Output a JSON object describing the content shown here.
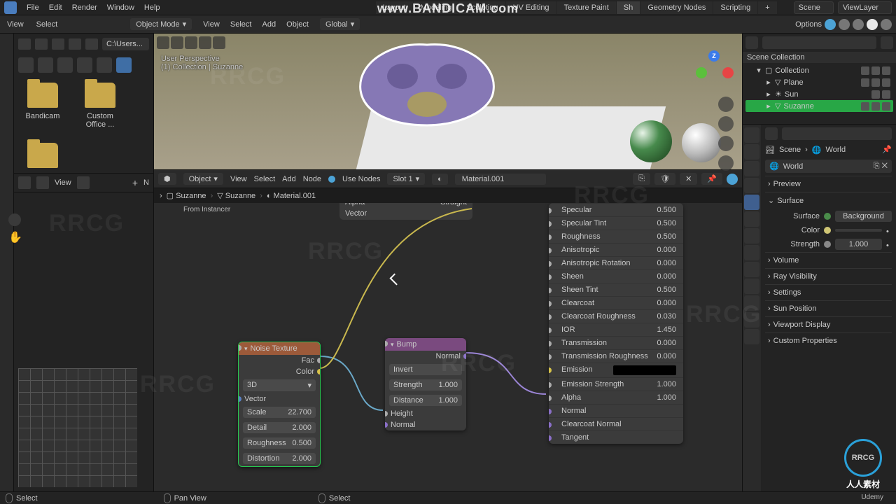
{
  "watermarks": {
    "bandicam": "www.BANDICAM.com",
    "rrcg": "RRCG",
    "rrcg_cn": "人人素材",
    "udemy": "Udemy"
  },
  "menu": {
    "file": "File",
    "edit": "Edit",
    "render": "Render",
    "window": "Window",
    "help": "Help"
  },
  "workspaces": {
    "layout": "Layout",
    "modeling": "Modeling",
    "sculpting": "Sculpting",
    "uv": "UV Editing",
    "texture": "Texture Paint",
    "shading": "Sh",
    "geometry": "Geometry Nodes",
    "scripting": "Scripting",
    "plus": "+"
  },
  "scene": {
    "scene_label": "Scene",
    "viewlayer_label": "ViewLayer"
  },
  "header3d": {
    "mode": "Object Mode",
    "view": "View",
    "select": "Select",
    "add": "Add",
    "object": "Object",
    "orientation": "Global",
    "options": "Options"
  },
  "vp_info": {
    "persp": "User Perspective",
    "coll": "(1) Collection | Suzanne"
  },
  "file_browser": {
    "tool_view": "View",
    "tool_select": "Select",
    "path": "C:\\Users...",
    "folders": [
      "Bandicam",
      "Custom Office ..."
    ]
  },
  "image_editor": {
    "view": "View",
    "plus": "+",
    "new": "N"
  },
  "node_header": {
    "object": "Object",
    "view": "View",
    "select": "Select",
    "add": "Add",
    "node": "Node",
    "use_nodes": "Use Nodes",
    "slot": "Slot 1",
    "material": "Material.001"
  },
  "breadcrumb": {
    "a": "Suzanne",
    "b": "Suzanne",
    "c": "Material.001"
  },
  "instancer": {
    "from": "From Instancer",
    "alpha": "Alpha",
    "straight": "Straight",
    "vector": "Vector"
  },
  "nodes": {
    "noise": {
      "title": "Noise Texture",
      "fac": "Fac",
      "color": "Color",
      "dim": "3D",
      "vector": "Vector",
      "scale_l": "Scale",
      "scale_v": "22.700",
      "detail_l": "Detail",
      "detail_v": "2.000",
      "rough_l": "Roughness",
      "rough_v": "0.500",
      "dist_l": "Distortion",
      "dist_v": "2.000"
    },
    "bump": {
      "title": "Bump",
      "normal_out": "Normal",
      "invert": "Invert",
      "strength_l": "Strength",
      "strength_v": "1.000",
      "distance_l": "Distance",
      "distance_v": "1.000",
      "height": "Height",
      "normal_in": "Normal"
    },
    "bsdf": {
      "specular_l": "Specular",
      "specular_v": "0.500",
      "spectint_l": "Specular Tint",
      "spectint_v": "0.500",
      "rough_l": "Roughness",
      "rough_v": "0.500",
      "aniso_l": "Anisotropic",
      "aniso_v": "0.000",
      "anisrot_l": "Anisotropic Rotation",
      "anisrot_v": "0.000",
      "sheen_l": "Sheen",
      "sheen_v": "0.000",
      "sheentint_l": "Sheen Tint",
      "sheentint_v": "0.500",
      "clear_l": "Clearcoat",
      "clear_v": "0.000",
      "clearr_l": "Clearcoat Roughness",
      "clearr_v": "0.030",
      "ior_l": "IOR",
      "ior_v": "1.450",
      "trans_l": "Transmission",
      "trans_v": "0.000",
      "transr_l": "Transmission Roughness",
      "transr_v": "0.000",
      "emission_l": "Emission",
      "emstr_l": "Emission Strength",
      "emstr_v": "1.000",
      "alpha_l": "Alpha",
      "alpha_v": "1.000",
      "normal_l": "Normal",
      "cnormal_l": "Clearcoat Normal",
      "tangent_l": "Tangent"
    }
  },
  "outliner": {
    "title": "Scene Collection",
    "collection": "Collection",
    "plane": "Plane",
    "sun": "Sun",
    "suzanne": "Suzanne"
  },
  "props": {
    "scene": "Scene",
    "world": "World",
    "world2": "World",
    "preview": "Preview",
    "surface_panel": "Surface",
    "surface_l": "Surface",
    "surface_v": "Background",
    "color_l": "Color",
    "strength_l": "Strength",
    "strength_v": "1.000",
    "volume": "Volume",
    "ray": "Ray Visibility",
    "settings": "Settings",
    "sunpos": "Sun Position",
    "vpdisp": "Viewport Display",
    "custom": "Custom Properties"
  },
  "status": {
    "select": "Select",
    "pan": "Pan View"
  }
}
